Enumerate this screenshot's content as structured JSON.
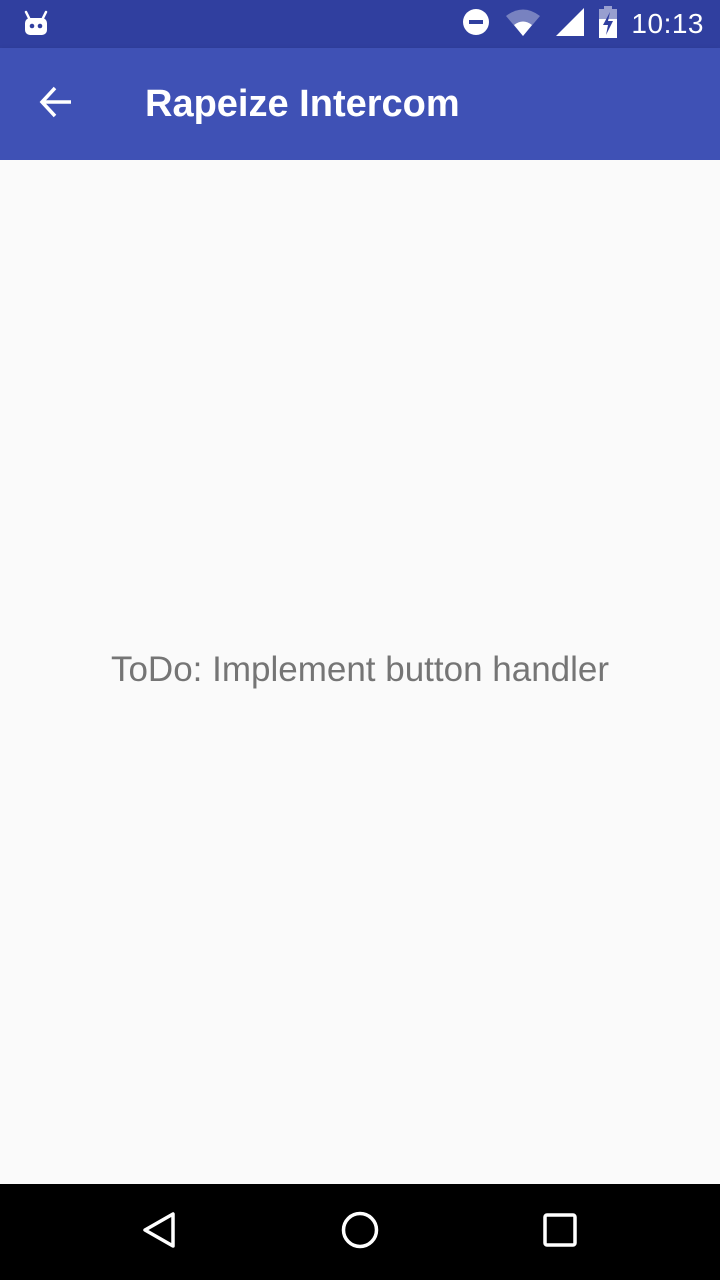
{
  "status_bar": {
    "notification_icon": "android-robot-icon",
    "icons": [
      "do-not-disturb-icon",
      "wifi-icon",
      "cell-signal-icon",
      "battery-charging-icon"
    ],
    "time": "10:13",
    "background": "#303f9f"
  },
  "app_bar": {
    "back_icon": "arrow-back-icon",
    "title": "Rapeize Intercom",
    "background": "#3f51b5"
  },
  "content": {
    "message": "ToDo: Implement button handler",
    "background": "#fafafa",
    "text_color": "#757575"
  },
  "nav_bar": {
    "buttons": [
      "back-triangle-icon",
      "home-circle-icon",
      "recents-square-icon"
    ]
  }
}
